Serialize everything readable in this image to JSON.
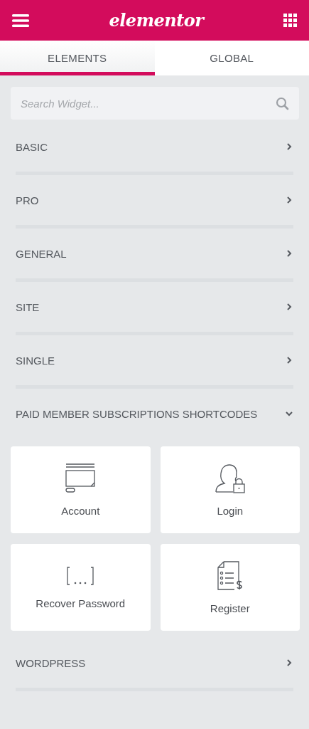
{
  "header": {
    "logo": "elementor"
  },
  "tabs": [
    {
      "label": "ELEMENTS",
      "selected": true
    },
    {
      "label": "GLOBAL",
      "selected": false
    }
  ],
  "search": {
    "placeholder": "Search Widget..."
  },
  "categories": [
    {
      "title": "BASIC",
      "expanded": false
    },
    {
      "title": "PRO",
      "expanded": false
    },
    {
      "title": "GENERAL",
      "expanded": false
    },
    {
      "title": "SITE",
      "expanded": false
    },
    {
      "title": "SINGLE",
      "expanded": false
    },
    {
      "title": "PAID MEMBER SUBSCRIPTIONS SHORTCODES",
      "expanded": true,
      "widgets": [
        {
          "label": "Account",
          "kind": "account"
        },
        {
          "label": "Login",
          "kind": "login"
        },
        {
          "label": "Recover Password",
          "kind": "shortcode"
        },
        {
          "label": "Register",
          "kind": "register"
        }
      ]
    },
    {
      "title": "WORDPRESS",
      "expanded": false
    }
  ]
}
